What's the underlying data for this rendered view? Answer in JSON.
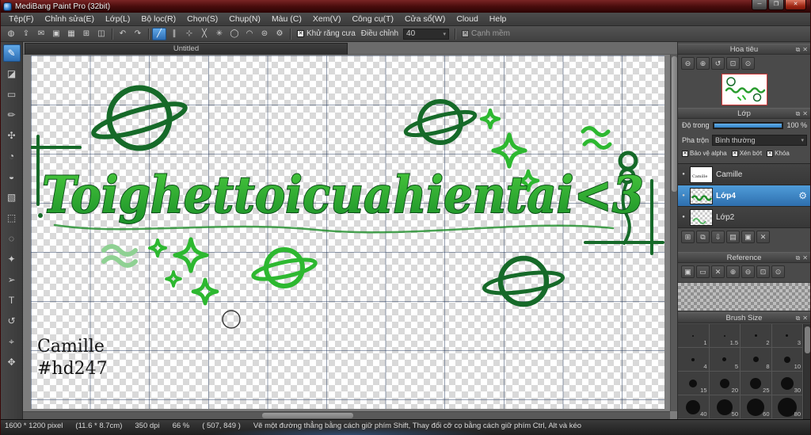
{
  "window": {
    "title": "MediBang Paint Pro (32bit)"
  },
  "titlebar": {
    "minimize": "─",
    "maximize": "❐",
    "close": "✕"
  },
  "menu": {
    "items": [
      "Tệp(F)",
      "Chỉnh sửa(E)",
      "Lớp(L)",
      "Bộ lọc(R)",
      "Chọn(S)",
      "Chụp(N)",
      "Màu (C)",
      "Xem(V)",
      "Công cụ(T)",
      "Cửa sổ(W)",
      "Cloud",
      "Help"
    ]
  },
  "toolbar": {
    "left_icons": [
      "◍",
      "⇪",
      "✉",
      "▣",
      "▦",
      "⊞",
      "◫"
    ],
    "undo": "↶",
    "redo": "↷",
    "snap_icons": [
      "╱",
      "∥",
      "⊹",
      "╳",
      "✳",
      "◯",
      "◠",
      "⊜",
      "⚙"
    ],
    "antialias_label": "Khử răng cưa",
    "adjust_label": "Điều chỉnh",
    "adjust_value": "40",
    "soft_edge_label": "Cạnh mềm",
    "check_glyph": "✕",
    "dropdown_arrow": "▾"
  },
  "tools": {
    "strip": [
      "✎",
      "◪",
      "▭",
      "✏",
      "✣",
      "◔",
      "◒",
      "▧",
      "⬚",
      "◌",
      "✦",
      "➢",
      "T",
      "↺",
      "⌖",
      "✥"
    ]
  },
  "canvas": {
    "tab_title": "Untitled",
    "artwork_text": "Toighettoicuahientai<3",
    "signature": [
      "Camille",
      "#hd247"
    ]
  },
  "header_icons": {
    "popout": "⧉",
    "close": "✕"
  },
  "panels": {
    "navigator": {
      "title": "Hoa tiêu",
      "buttons": [
        "⊖",
        "⊕",
        "↺",
        "⊡",
        "⊙"
      ]
    },
    "layers": {
      "title": "Lớp",
      "opacity_label": "Độ trong",
      "opacity_value": "100 %",
      "blend_label": "Pha trộn",
      "blend_value": "Bình thường",
      "checks": [
        "Bảo vệ alpha",
        "Xén bớt",
        "Khóa"
      ],
      "items": [
        {
          "name": "Camille"
        },
        {
          "name": "Lớp4"
        },
        {
          "name": "Lớp2"
        }
      ],
      "buttons": [
        "⊞",
        "⧉",
        "⇩",
        "▤",
        "▣",
        "✕"
      ]
    },
    "reference": {
      "title": "Reference",
      "buttons": [
        "▣",
        "▭",
        "✕",
        "⊕",
        "⊖",
        "⊡",
        "⊙"
      ]
    },
    "brush_size": {
      "title": "Brush Size",
      "sizes": [
        "1",
        "1.5",
        "2",
        "3",
        "4",
        "5",
        "8",
        "10",
        "15",
        "20",
        "25",
        "30",
        "40",
        "50",
        "60",
        "80"
      ]
    }
  },
  "statusbar": {
    "size": "1600 * 1200 pixel",
    "physical": "(11.6 * 8.7cm)",
    "dpi": "350 dpi",
    "zoom": "66 %",
    "coords": "( 507, 849 )",
    "hint": "Vẽ một đường thẳng bằng cách giữ phím Shift, Thay đổi cỡ cọ bằng cách giữ phím Ctrl, Alt và kéo"
  },
  "colors": {
    "selection_blue": "#3a85c8",
    "artwork_green_dark": "#166a29",
    "artwork_green_bright": "#2db830",
    "artwork_green_light": "#8fd193",
    "thumb_border_red": "#cf3a3a",
    "titlebar_maroon": "#4a0d0d"
  }
}
